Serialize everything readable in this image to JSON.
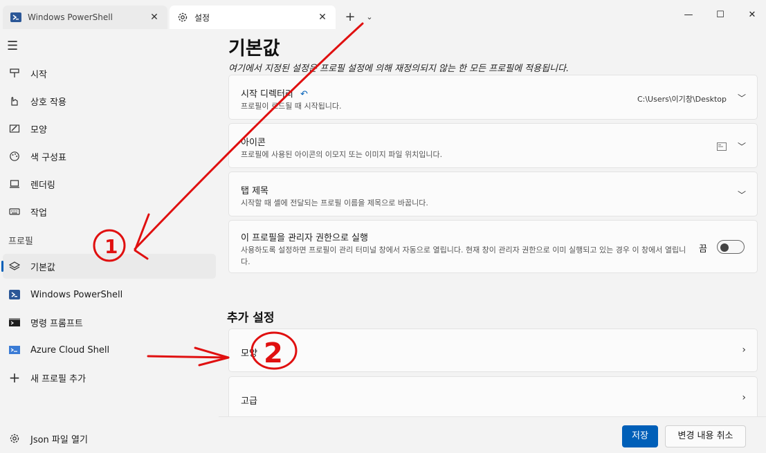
{
  "tabs": [
    {
      "label": "Windows PowerShell",
      "active": false
    },
    {
      "label": "설정",
      "active": true
    }
  ],
  "titlebar": {
    "close_glyph": "✕",
    "new_tab_glyph": "+",
    "dropdown_glyph": "⌄",
    "minimize_glyph": "—",
    "maximize_glyph": "☐"
  },
  "sidebar": {
    "items": [
      {
        "label": "시작",
        "icon": "start-icon"
      },
      {
        "label": "상호 작용",
        "icon": "interaction-icon"
      },
      {
        "label": "모양",
        "icon": "appearance-icon"
      },
      {
        "label": "색 구성표",
        "icon": "palette-icon"
      },
      {
        "label": "렌더링",
        "icon": "monitor-icon"
      },
      {
        "label": "작업",
        "icon": "keyboard-icon"
      }
    ],
    "profiles_header": "프로필",
    "profiles": [
      {
        "label": "기본값",
        "icon": "layers-icon",
        "selected": true
      },
      {
        "label": "Windows PowerShell",
        "icon": "powershell-icon"
      },
      {
        "label": "명령 프롬프트",
        "icon": "cmd-icon"
      },
      {
        "label": "Azure Cloud Shell",
        "icon": "azure-icon"
      },
      {
        "label": "새 프로필 추가",
        "icon": "plus-icon"
      }
    ],
    "open_json": "Json 파일 열기"
  },
  "main": {
    "title": "기본값",
    "subtitle": "여기에서 지정된 설정은 프로필 설정에 의해 재정의되지 않는 한 모든 프로필에 적용됩니다.",
    "cards": [
      {
        "title": "시작 디렉터리",
        "desc": "프로필이 로드될 때 시작됩니다.",
        "value": "C:\\Users\\이기창\\Desktop"
      },
      {
        "title": "아이콘",
        "desc": "프로필에 사용된 아이콘의 이모지 또는 이미지 파일 위치입니다."
      },
      {
        "title": "탭 제목",
        "desc": "시작할 때 셸에 전달되는 프로필 이름을 제목으로 바꿉니다."
      },
      {
        "title": "이 프로필을 관리자 권한으로 실행",
        "desc": "사용하도록 설정하면 프로필이 관리 터미널 창에서 자동으로 열립니다. 현재 창이 관리자 권한으로 이미 실행되고 있는 경우 이 창에서 열립니다.",
        "toggle_label": "끔",
        "toggle_on": false
      }
    ],
    "additional_title": "추가 설정",
    "additional": [
      {
        "label": "모양"
      },
      {
        "label": "고급"
      }
    ]
  },
  "footer": {
    "save": "저장",
    "discard": "변경 내용 취소"
  },
  "annotations": [
    "1",
    "2"
  ],
  "colors": {
    "accent": "#005fb8",
    "annotation": "#e01010"
  }
}
